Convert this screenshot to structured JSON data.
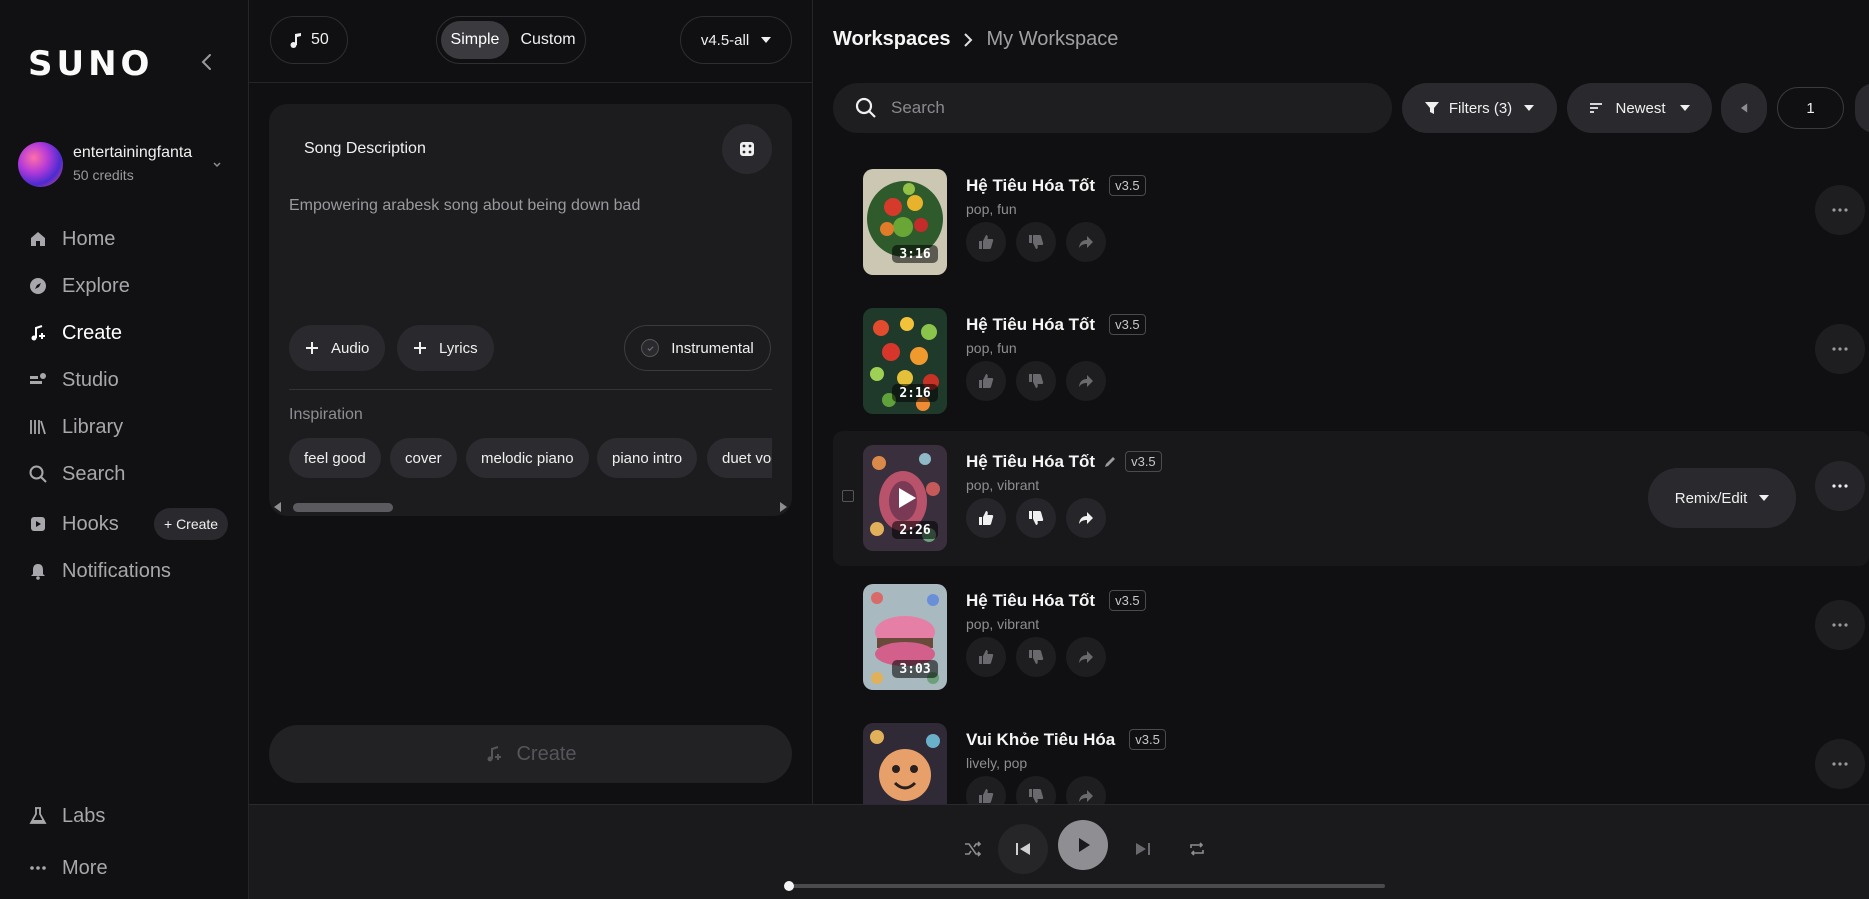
{
  "sidebar": {
    "logo": "SUNO",
    "user": {
      "name": "entertainingfanta",
      "credits": "50 credits"
    },
    "nav": [
      {
        "label": "Home",
        "icon": "home-icon"
      },
      {
        "label": "Explore",
        "icon": "compass-icon"
      },
      {
        "label": "Create",
        "icon": "music-plus-icon",
        "active": true
      },
      {
        "label": "Studio",
        "icon": "studio-icon"
      },
      {
        "label": "Library",
        "icon": "library-icon"
      },
      {
        "label": "Search",
        "icon": "search-icon"
      },
      {
        "label": "Hooks",
        "icon": "hooks-icon"
      },
      {
        "label": "Notifications",
        "icon": "bell-icon"
      }
    ],
    "hooks_create": "+ Create",
    "bottom": [
      {
        "label": "Labs",
        "icon": "flask-icon"
      },
      {
        "label": "More",
        "icon": "more-icon"
      }
    ]
  },
  "create_panel": {
    "credits": "50",
    "modes": {
      "simple": "Simple",
      "custom": "Custom",
      "selected": "Simple"
    },
    "model": "v4.5-all",
    "description_label": "Song Description",
    "description_text": "Empowering arabesk song about being down bad",
    "audio_btn": "Audio",
    "lyrics_btn": "Lyrics",
    "instrumental_btn": "Instrumental",
    "inspiration_label": "Inspiration",
    "chips": [
      "feel good",
      "cover",
      "melodic piano",
      "piano intro",
      "duet vocals"
    ],
    "create_btn": "Create"
  },
  "workspace": {
    "breadcrumb": {
      "root": "Workspaces",
      "current": "My Workspace"
    },
    "search_placeholder": "Search",
    "filters": "Filters (3)",
    "sort": "Newest",
    "page": "1",
    "songs": [
      {
        "title": "Hệ Tiêu Hóa Tốt",
        "version": "v3.5",
        "tags": "pop, fun",
        "duration": "3:16"
      },
      {
        "title": "Hệ Tiêu Hóa Tốt",
        "version": "v3.5",
        "tags": "pop, fun",
        "duration": "2:16"
      },
      {
        "title": "Hệ Tiêu Hóa Tốt",
        "version": "v3.5",
        "tags": "pop, vibrant",
        "duration": "2:26",
        "hovered": true
      },
      {
        "title": "Hệ Tiêu Hóa Tốt",
        "version": "v3.5",
        "tags": "pop, vibrant",
        "duration": "3:03"
      },
      {
        "title": "Vui Khỏe Tiêu Hóa",
        "version": "v3.5",
        "tags": "lively, pop",
        "duration": ""
      }
    ],
    "remix_btn": "Remix/Edit"
  },
  "player": {
    "progress": 0
  }
}
